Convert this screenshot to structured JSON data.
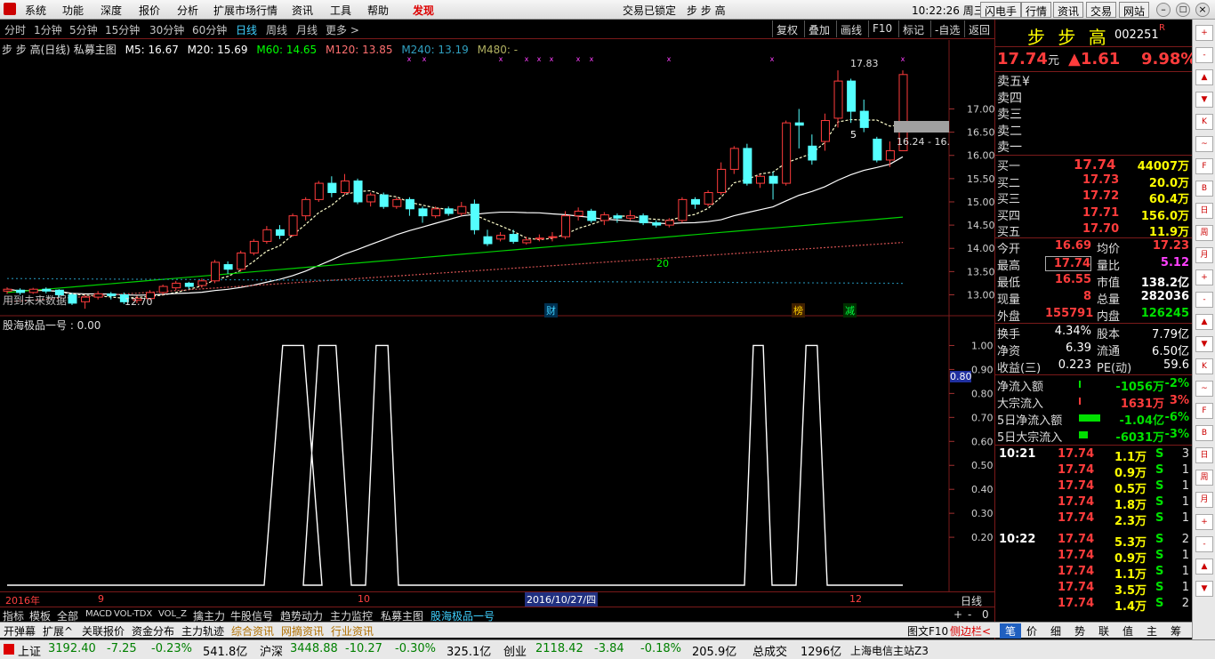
{
  "menu": {
    "items": [
      "系统",
      "功能",
      "深度",
      "报价",
      "分析",
      "扩展市场行情",
      "资讯",
      "工具",
      "帮助",
      "发现"
    ],
    "center_status": "交易已锁定",
    "center_stock": "步 步 高",
    "clock": "10:22:26 周三",
    "right_buttons": [
      "闪电手",
      "行情",
      "资讯",
      "交易",
      "网站"
    ]
  },
  "periods": [
    "分时",
    "1分钟",
    "5分钟",
    "15分钟",
    "30分钟",
    "60分钟",
    "日线",
    "周线",
    "月线",
    "更多 >"
  ],
  "toolbar_buttons": [
    "复权",
    "叠加",
    "画线",
    "F10",
    "标记",
    "-自选",
    "返回"
  ],
  "chart_header": {
    "stock": "步 步 高(日线) 私募主图",
    "mas": [
      {
        "label": "M5: 16.67",
        "color": "#ffffff"
      },
      {
        "label": "M20: 15.69",
        "color": "#ffffff"
      },
      {
        "label": "M60: 14.65",
        "color": "#00ff00"
      },
      {
        "label": "M120: 13.85",
        "color": "#ff7070"
      },
      {
        "label": "M240: 13.19",
        "color": "#30a0c0"
      },
      {
        "label": "M480: -",
        "color": "#b0b060"
      }
    ]
  },
  "price_axis": [
    "17.00",
    "16.50",
    "16.00",
    "15.50",
    "15.00",
    "14.50",
    "14.00",
    "13.50",
    "13.00"
  ],
  "chart_annotations": {
    "high": "17.83",
    "low": "12.70",
    "ma20": "20",
    "m5": "5",
    "range": "16.24 - 16.",
    "future": "用到未来数据",
    "caibao": "财",
    "bang": "榜",
    "jian": "减"
  },
  "indicator": {
    "title": "股海极品一号 : 0.00",
    "axis": [
      "1.00",
      "0.90",
      "0.80",
      "0.70",
      "0.60",
      "0.50",
      "0.40",
      "0.30",
      "0.20"
    ],
    "current": "0.80"
  },
  "time_axis": {
    "year": "2016年",
    "m9": "9",
    "m10": "10",
    "m12": "12",
    "cursor": "2016/10/27/四",
    "period": "日线"
  },
  "candles": [
    [
      13.08,
      13.12,
      13.02,
      13.16
    ],
    [
      13.1,
      13.05,
      13.0,
      13.14
    ],
    [
      13.05,
      13.12,
      13.02,
      13.15
    ],
    [
      13.12,
      13.08,
      13.03,
      13.16
    ],
    [
      13.1,
      13.0,
      12.95,
      13.12
    ],
    [
      13.0,
      12.82,
      12.78,
      13.04
    ],
    [
      12.85,
      12.95,
      12.7,
      13.0
    ],
    [
      12.95,
      13.02,
      12.9,
      13.08
    ],
    [
      13.02,
      12.98,
      12.9,
      13.06
    ],
    [
      13.0,
      12.85,
      12.8,
      13.05
    ],
    [
      12.88,
      12.92,
      12.82,
      12.98
    ],
    [
      12.92,
      13.05,
      12.88,
      13.1
    ],
    [
      13.05,
      13.18,
      13.0,
      13.22
    ],
    [
      13.15,
      13.25,
      13.1,
      13.3
    ],
    [
      13.25,
      13.18,
      13.12,
      13.28
    ],
    [
      13.2,
      13.3,
      13.15,
      13.35
    ],
    [
      13.3,
      13.7,
      13.25,
      13.75
    ],
    [
      13.65,
      13.55,
      13.45,
      13.72
    ],
    [
      13.55,
      13.9,
      13.5,
      13.95
    ],
    [
      13.9,
      14.15,
      13.85,
      14.2
    ],
    [
      14.15,
      14.4,
      14.1,
      14.48
    ],
    [
      14.4,
      14.28,
      14.2,
      14.5
    ],
    [
      14.28,
      14.7,
      14.25,
      14.75
    ],
    [
      14.7,
      15.05,
      14.6,
      15.1
    ],
    [
      15.05,
      15.4,
      15.0,
      15.45
    ],
    [
      15.4,
      15.2,
      15.1,
      15.55
    ],
    [
      15.2,
      15.45,
      15.15,
      15.6
    ],
    [
      15.45,
      15.0,
      14.95,
      15.5
    ],
    [
      15.0,
      15.15,
      14.9,
      15.2
    ],
    [
      15.15,
      14.9,
      14.85,
      15.2
    ],
    [
      14.9,
      15.05,
      14.85,
      15.1
    ],
    [
      15.05,
      14.85,
      14.7,
      15.1
    ],
    [
      14.85,
      14.7,
      14.55,
      14.9
    ],
    [
      14.7,
      14.85,
      14.65,
      14.9
    ],
    [
      14.85,
      14.75,
      14.7,
      14.9
    ],
    [
      14.75,
      14.9,
      14.7,
      15.0
    ],
    [
      14.95,
      14.4,
      14.3,
      15.05
    ],
    [
      14.25,
      14.1,
      14.05,
      14.4
    ],
    [
      14.2,
      14.28,
      14.15,
      14.35
    ],
    [
      14.3,
      14.15,
      14.1,
      14.4
    ],
    [
      14.12,
      14.18,
      14.08,
      14.25
    ],
    [
      14.2,
      14.22,
      14.15,
      14.3
    ],
    [
      14.25,
      14.25,
      14.15,
      14.35
    ],
    [
      14.25,
      14.7,
      14.2,
      14.8
    ],
    [
      14.7,
      14.8,
      14.6,
      14.88
    ],
    [
      14.8,
      14.6,
      14.55,
      14.85
    ],
    [
      14.6,
      14.72,
      14.5,
      14.78
    ],
    [
      14.7,
      14.65,
      14.55,
      14.75
    ],
    [
      14.65,
      14.7,
      14.6,
      14.82
    ],
    [
      14.7,
      14.55,
      14.5,
      14.75
    ],
    [
      14.55,
      14.5,
      14.45,
      14.6
    ],
    [
      14.5,
      14.6,
      14.45,
      14.65
    ],
    [
      14.6,
      15.05,
      14.55,
      15.1
    ],
    [
      15.05,
      14.95,
      14.85,
      15.1
    ],
    [
      14.95,
      15.2,
      14.9,
      15.25
    ],
    [
      15.2,
      15.7,
      15.15,
      15.85
    ],
    [
      15.7,
      16.15,
      15.6,
      16.2
    ],
    [
      16.15,
      15.4,
      15.35,
      16.25
    ],
    [
      15.4,
      15.55,
      15.3,
      15.6
    ],
    [
      15.55,
      15.4,
      15.05,
      15.65
    ],
    [
      15.4,
      16.7,
      15.35,
      16.75
    ],
    [
      16.7,
      16.65,
      16.15,
      17.0
    ],
    [
      16.2,
      15.9,
      15.8,
      16.45
    ],
    [
      16.3,
      16.75,
      16.1,
      16.9
    ],
    [
      16.8,
      17.6,
      16.6,
      17.83
    ],
    [
      17.6,
      16.95,
      16.7,
      17.65
    ],
    [
      16.95,
      16.6,
      16.5,
      17.2
    ],
    [
      16.35,
      15.9,
      15.85,
      16.4
    ],
    [
      15.9,
      16.1,
      15.75,
      16.3
    ],
    [
      16.1,
      17.74,
      16.1,
      17.83
    ]
  ],
  "indicator_series": [
    0,
    0,
    0,
    0,
    0,
    0,
    0,
    0,
    0,
    0,
    0,
    0,
    0,
    0,
    0,
    0,
    0,
    0,
    0,
    0,
    0,
    0,
    0,
    0,
    0,
    0,
    0,
    0,
    0,
    0,
    0,
    0,
    0,
    0,
    0,
    0,
    0,
    0,
    0,
    0,
    0,
    0,
    0,
    0,
    0,
    0,
    0,
    0,
    0,
    0,
    0,
    0,
    0,
    0,
    0,
    0,
    0,
    0,
    0,
    0,
    0,
    0,
    0,
    0,
    0,
    0,
    0,
    0,
    0,
    0
  ],
  "quote": {
    "name": "步 步 高",
    "code": "002251",
    "badge": "R",
    "price": "17.74",
    "unit": "元",
    "change": "▲1.61",
    "pct": "9.98%",
    "asks": [
      {
        "lbl": "卖五",
        "v": "¥"
      },
      {
        "lbl": "卖四",
        "v": ""
      },
      {
        "lbl": "卖三",
        "v": ""
      },
      {
        "lbl": "卖二",
        "v": ""
      },
      {
        "lbl": "卖一",
        "v": ""
      }
    ],
    "bids": [
      {
        "lbl": "买一",
        "p": "17.74",
        "v": "44007万"
      },
      {
        "lbl": "买二",
        "p": "17.73",
        "v": "20.0万"
      },
      {
        "lbl": "买三",
        "p": "17.72",
        "v": "60.4万"
      },
      {
        "lbl": "买四",
        "p": "17.71",
        "v": "156.0万"
      },
      {
        "lbl": "买五",
        "p": "17.70",
        "v": "11.9万"
      }
    ],
    "stats": [
      {
        "l1": "今开",
        "v1": "16.69",
        "l2": "均价",
        "v2": "17.23"
      },
      {
        "l1": "最高",
        "v1": "17.74",
        "l2": "量比",
        "v2": "5.12"
      },
      {
        "l1": "最低",
        "v1": "16.55",
        "l2": "市值",
        "v2": "138.2亿"
      },
      {
        "l1": "现量",
        "v1": "8",
        "l2": "总量",
        "v2": "282036"
      },
      {
        "l1": "外盘",
        "v1": "155791",
        "l2": "内盘",
        "v2": "126245"
      }
    ],
    "stats2": [
      {
        "l1": "换手",
        "v1": "4.34%",
        "l2": "股本",
        "v2": "7.79亿"
      },
      {
        "l1": "净资",
        "v1": "6.39",
        "l2": "流通",
        "v2": "6.50亿"
      },
      {
        "l1": "收益(三)",
        "v1": "0.223",
        "l2": "PE(动)",
        "v2": "59.6"
      }
    ],
    "flows": [
      {
        "l": "净流入额",
        "v": "-1056万",
        "p": "-2%"
      },
      {
        "l": "大宗流入",
        "v": "1631万",
        "p": "3%"
      },
      {
        "l": "5日净流入额",
        "v": "-1.04亿",
        "p": "-6%"
      },
      {
        "l": "5日大宗流入",
        "v": "-6031万",
        "p": "-3%"
      }
    ],
    "ticks": [
      {
        "t": "10:21",
        "p": "17.74",
        "v": "1.1万",
        "s": "S",
        "n": "3"
      },
      {
        "t": "",
        "p": "17.74",
        "v": "0.9万",
        "s": "S",
        "n": "1"
      },
      {
        "t": "",
        "p": "17.74",
        "v": "0.5万",
        "s": "S",
        "n": "1"
      },
      {
        "t": "",
        "p": "17.74",
        "v": "1.8万",
        "s": "S",
        "n": "1"
      },
      {
        "t": "",
        "p": "17.74",
        "v": "2.3万",
        "s": "S",
        "n": "1"
      },
      {
        "t": "10:22",
        "p": "17.74",
        "v": "5.3万",
        "s": "S",
        "n": "2"
      },
      {
        "t": "",
        "p": "17.74",
        "v": "0.9万",
        "s": "S",
        "n": "1"
      },
      {
        "t": "",
        "p": "17.74",
        "v": "1.1万",
        "s": "S",
        "n": "1"
      },
      {
        "t": "",
        "p": "17.74",
        "v": "3.5万",
        "s": "S",
        "n": "1"
      },
      {
        "t": "",
        "p": "17.74",
        "v": "1.4万",
        "s": "S",
        "n": "2"
      }
    ]
  },
  "tabs1": [
    "指标",
    "模板",
    "全部",
    "MACD",
    "VOL-TDX",
    "VOL_Z",
    "擒主力",
    "牛股信号",
    "趋势动力",
    "主力监控",
    "私募主图",
    "股海极品一号"
  ],
  "tabs2": [
    "开弹幕",
    "扩展^",
    "关联报价",
    "资金分布",
    "主力轨迹",
    "综合资讯",
    "网摘资讯",
    "行业资讯"
  ],
  "tabs2_right": [
    "图文F10",
    "侧边栏<"
  ],
  "rtabs": [
    "笔",
    "价",
    "细",
    "势",
    "联",
    "值",
    "主",
    "筹"
  ],
  "status": {
    "sh_lbl": "上证",
    "sh": "3192.40",
    "sh_c": "-7.25",
    "sh_p": "-0.23%",
    "sh_a": "541.8亿",
    "hs_lbl": "沪深",
    "hs": "3448.88",
    "hs_c": "-10.27",
    "hs_p": "-0.30%",
    "hs_a": "325.1亿",
    "cy_lbl": "创业",
    "cy": "2118.42",
    "cy_c": "-3.84",
    "cy_p": "-0.18%",
    "cy_a": "205.9亿",
    "tot_lbl": "总成交",
    "tot": "1296亿",
    "server": "上海电信主站Z3"
  },
  "sidebar_icons": [
    "+",
    "-",
    "▲",
    "▼",
    "K",
    "~",
    "F",
    "B",
    "日",
    "周",
    "月"
  ]
}
